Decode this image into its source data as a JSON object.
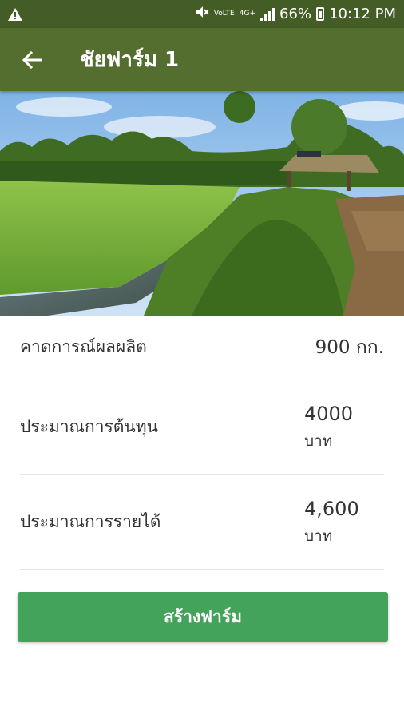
{
  "status_bar": {
    "battery": "66%",
    "time": "10:12 PM",
    "volte_label": "VoLTE",
    "network_label": "4G+"
  },
  "app_bar": {
    "title": "ชัยฟาร์ม 1"
  },
  "rows": [
    {
      "label": "คาดการณ์ผลผลิต",
      "value": "900 กก."
    },
    {
      "label": "ประมาณการต้นทุน",
      "value": "4000",
      "unit": "บาท"
    },
    {
      "label": "ประมาณการรายได้",
      "value": "4,600",
      "unit": "บาท"
    }
  ],
  "create_button": {
    "label": "สร้างฟาร์ม"
  },
  "colors": {
    "status_bar": "#445c25",
    "app_bar": "#546e2f",
    "button": "#43a35a"
  }
}
